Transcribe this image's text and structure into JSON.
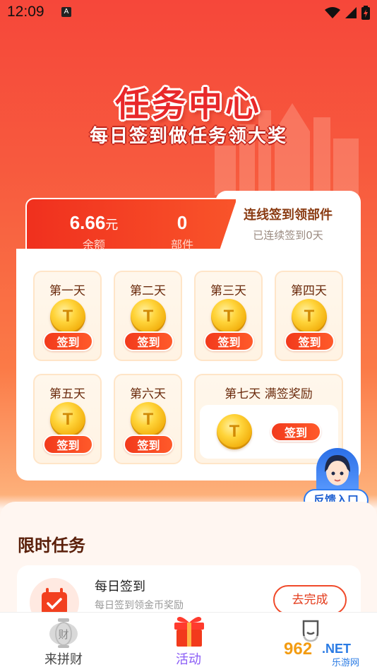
{
  "status_bar": {
    "time": "12:09",
    "a_glyph": "A"
  },
  "hero": {
    "title": "任务中心",
    "subtitle": "每日签到做任务领大奖"
  },
  "stats": {
    "balance_value": "6.66",
    "balance_unit": "元",
    "balance_label": "余额",
    "parts_value": "0",
    "parts_label": "部件"
  },
  "streak": {
    "title": "连线签到领部件",
    "subtitle": "已连续签到0天"
  },
  "days": [
    {
      "name": "第一天",
      "button": "签到"
    },
    {
      "name": "第二天",
      "button": "签到"
    },
    {
      "name": "第三天",
      "button": "签到"
    },
    {
      "name": "第四天",
      "button": "签到"
    },
    {
      "name": "第五天",
      "button": "签到"
    },
    {
      "name": "第六天",
      "button": "签到"
    },
    {
      "name": "第七天 满签奖励",
      "button": "签到"
    }
  ],
  "feedback": {
    "label": "反馈入口"
  },
  "tasks": {
    "title": "限时任务",
    "items": [
      {
        "name": "每日签到",
        "desc": "每日签到领金币奖励",
        "button": "去完成"
      }
    ]
  },
  "nav": {
    "items": [
      {
        "label": "来拼财",
        "icon": "lantern-icon",
        "active": false
      },
      {
        "label": "活动",
        "icon": "gift-icon",
        "active": true
      },
      {
        "label": "",
        "icon": "profile-icon",
        "active": false
      }
    ],
    "active_color": "#8a5cf6",
    "inactive_color": "#444444"
  },
  "watermark": {
    "brand": "962",
    "suffix": ".NET",
    "caption": "乐游网"
  },
  "colors": {
    "primary": "#f23a1c",
    "feedback_blue": "#2d7cf0"
  }
}
